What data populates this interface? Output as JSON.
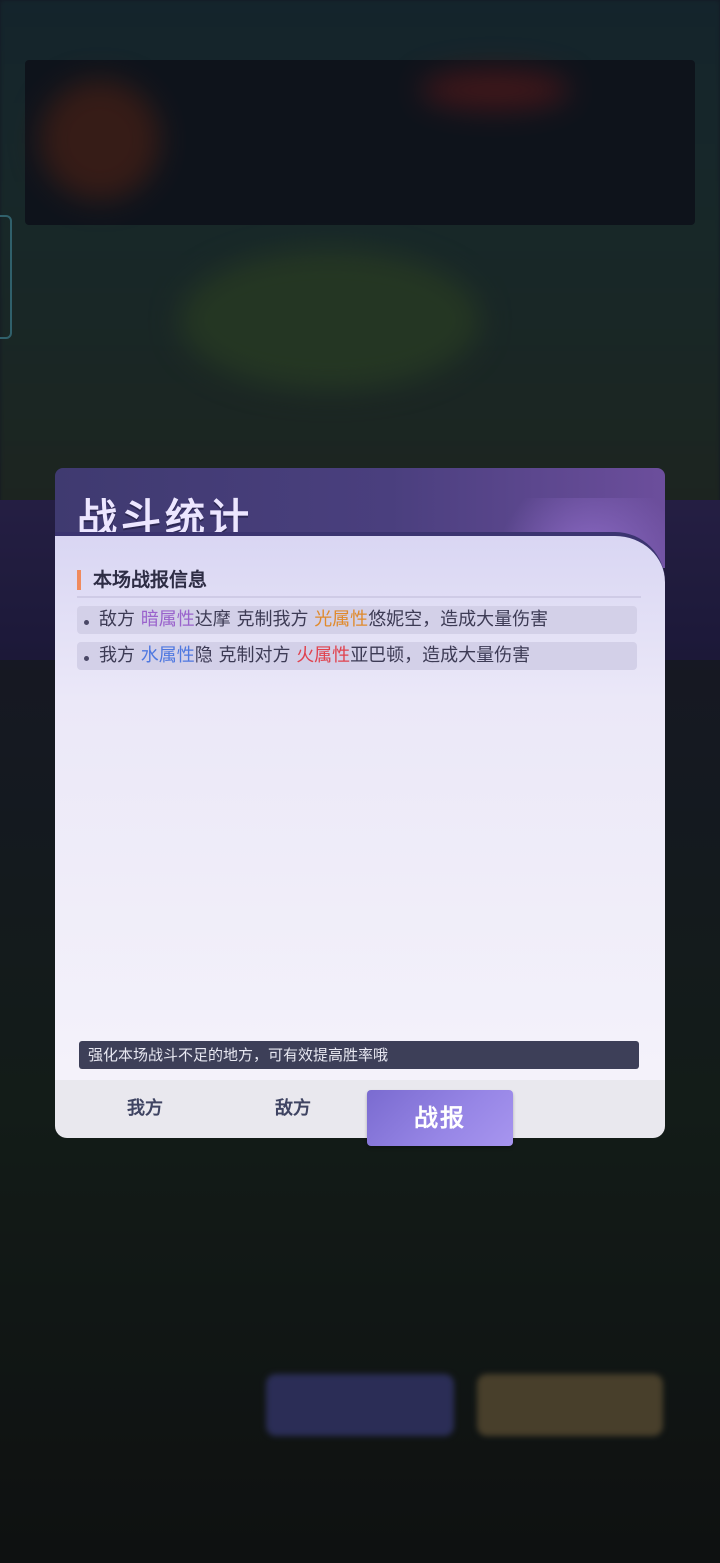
{
  "dialog": {
    "title": "战斗统计",
    "section_title": "本场战报信息",
    "reports": [
      {
        "t1": "敌方 ",
        "attr1": "暗属性",
        "t2": "达摩 克制我方 ",
        "attr2": "光属性",
        "t3": "悠妮空，造成大量伤害"
      },
      {
        "t1": "我方 ",
        "attr1": "水属性",
        "t2": "隐 克制对方 ",
        "attr2": "火属性",
        "t3": "亚巴顿，造成大量伤害"
      }
    ],
    "tip": "强化本场战斗不足的地方，可有效提高胜率哦",
    "tabs": {
      "ours": "我方",
      "enemy": "敌方",
      "report": "战报"
    }
  },
  "colors": {
    "dark_attr": "#9a63cc",
    "light_attr": "#e08a2c",
    "water_attr": "#4f78e0",
    "fire_attr": "#e0424e",
    "active_tab": "#8a79de",
    "section_accent": "#f08a5d"
  }
}
